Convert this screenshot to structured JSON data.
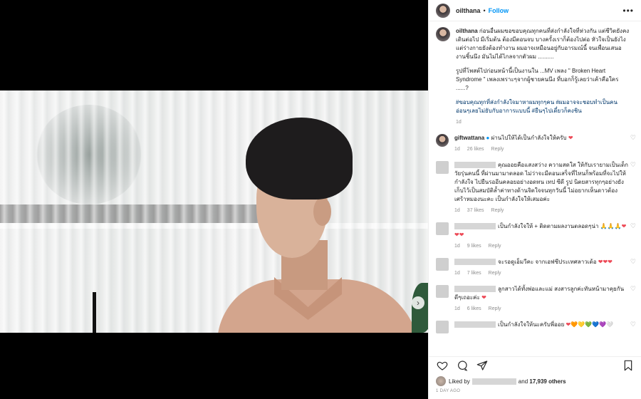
{
  "header": {
    "username": "oilthana",
    "separator": "•",
    "follow_label": "Follow",
    "more_label": "•••"
  },
  "caption": {
    "username": "oilthana",
    "text": "ก่อนอื่นผมขอขอบคุณทุกคนที่ส่งกำลังใจที่ห่วงกัน แต่ชีวิตยังคงเดินต่อไป มีเริ่มต้น ต้องมีตอนจบ บางครั้งเราก็ต้องไปต่อ หัวใจเป็นยังไงแต่ร่างกายยังต้องทำงาน ผมอาจเหมือนอยู่กับอารมณ์นี้ จนเพื่อนเสนองานชิ้นนึง มันไม่ได้ไกลจากตัวผม ..........",
    "text2": "รูปที่โพสต์ไปก่อนหน้านี้เป็นงานใน ...MV เพลง \" Broken Heart Syndrome \" เพลงเพราะๆจากผู้ชายคนนึง ที่บอกก็รู้เลยว่าเค้าคือใคร ......?",
    "hashtags": "#ขอบคุณทุกที่ส่งกำลังใจมาหาผมทุกๆคน #ผมอาจจะชอบทำเป็นคนอ่อนๆเลยไม่ยับกับอาการแบบนี้ #ยืนๆไปเดี๋ยวก็คงชิน",
    "time": "1d"
  },
  "comments": [
    {
      "username": "giftwattana",
      "verified": true,
      "text": "ผ่านไปให้ได้เป็นกำลังใจให้ครับ",
      "emoji": "❤",
      "time": "1d",
      "likes": "26 likes",
      "reply": "Reply"
    },
    {
      "username": "",
      "text": "คุณออยคือแสงสว่าง ความสดใส ให้กับเรายามเป็นเด็กวัยรุ่นคนนี้ ที่ผ่านมามาตลอด ไม่ว่าจะมีตอนเสร็จที่ไหนก็พร้อมที่จะไปให้กำลังใจ ไปยืนรออีนคลอยอย่างอดทน เทป ซีดี รูป นิตยสารทุกๆอย่างยังเก็บไว้เป็นสมบัติล้ำค่าทางด้านจิตใจจนทุกวันนี้ ไม่อยากเห็นดาวต้องเศร้าหมองนะคะ เป็นกำลังใจให้เสมอค่ะ",
      "emoji": "",
      "time": "1d",
      "likes": "37 likes",
      "reply": "Reply"
    },
    {
      "username": "",
      "text": "เป็นกำลังใจให้ + ติดตามผลงานตลอดๆน่า",
      "emoji": "🙏🙏🙏❤❤❤",
      "time": "1d",
      "likes": "9 likes",
      "reply": "Reply"
    },
    {
      "username": "",
      "text": "จะรอดูเอ็มวีคะ จากเอฟซีประเทศลาวเด้อ",
      "emoji": "❤❤❤",
      "time": "1d",
      "likes": "7 likes",
      "reply": "Reply"
    },
    {
      "username": "",
      "text": "ลูกสาวได้ทั้งพ่อและแม่ สงสารลูกค่ะทันหน้ามาคุยกันดีๆเถอะค่ะ",
      "emoji": "❤",
      "time": "1d",
      "likes": "6 likes",
      "reply": "Reply"
    },
    {
      "username": "",
      "text": "เป็นกำลังใจให้นะครับพี่ออย",
      "emoji": "❤🧡💛💚💙💜🤍",
      "time": "",
      "likes": "",
      "reply": ""
    }
  ],
  "likes": {
    "prefix": "Liked by",
    "suffix": "and",
    "count": "17,939 others"
  },
  "date": "1 DAY AGO",
  "carousel": {
    "slides": 5,
    "active": 0
  },
  "colors": {
    "follow": "#0095f6",
    "hashtag": "#00376b",
    "heart": "#ed4956",
    "meta": "#8e8e8e"
  },
  "icons": [
    "heart-icon",
    "comment-icon",
    "share-icon",
    "bookmark-icon",
    "chevron-right-icon",
    "more-icon"
  ]
}
